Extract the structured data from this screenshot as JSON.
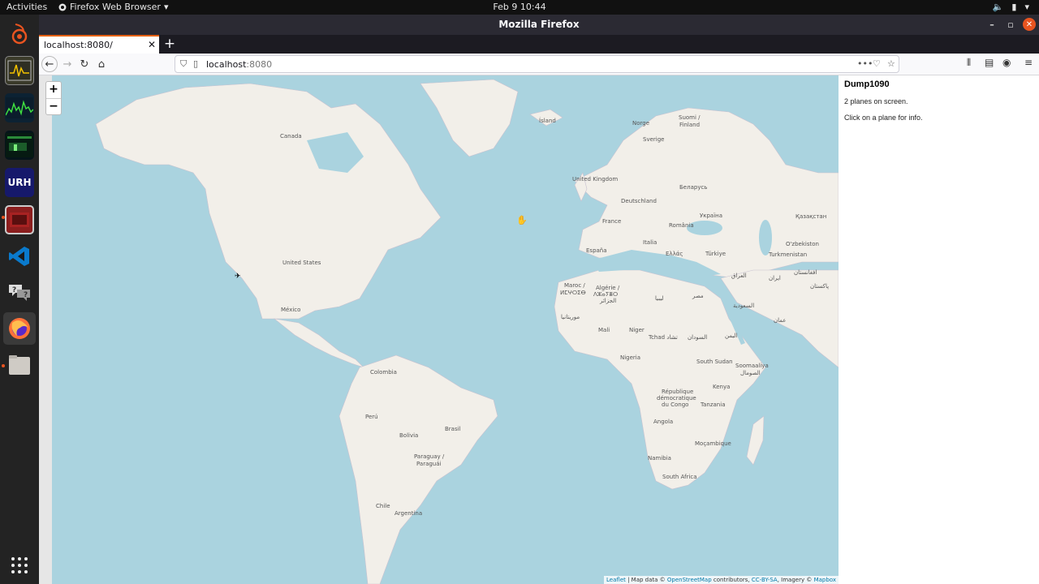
{
  "topbar": {
    "activities": "Activities",
    "app_menu": "Firefox Web Browser",
    "clock": "Feb 9  10:44"
  },
  "dock": {
    "items": [
      {
        "icon": "ubuntu-logo-icon"
      },
      {
        "icon": "oscilloscope-icon"
      },
      {
        "icon": "spectrum-icon"
      },
      {
        "icon": "waterfall-icon"
      },
      {
        "label": "URH",
        "icon": "urh-icon"
      },
      {
        "icon": "terminal-red-icon"
      },
      {
        "icon": "vscode-icon"
      },
      {
        "icon": "help-icon"
      },
      {
        "icon": "firefox-icon"
      },
      {
        "icon": "files-icon"
      },
      {
        "icon": "apps-grid-icon"
      }
    ]
  },
  "window": {
    "title": "Mozilla Firefox",
    "tab_title": "localhost:8080/",
    "url_host": "localhost",
    "url_port": ":8080"
  },
  "map": {
    "labels": [
      "Canada",
      "United States",
      "México",
      "Colombia",
      "Perú",
      "Brasil",
      "Bolivia",
      "Paraguay /",
      "Paraguái",
      "Chile",
      "Argentina",
      "Ísland",
      "Norge",
      "Sverige",
      "Suomi /",
      "Finland",
      "United Kingdom",
      "Deutschland",
      "France",
      "España",
      "Italia",
      "Беларусь",
      "Україна",
      "România",
      "Ελλάς",
      "Türkiye",
      "Қазақстан",
      "O'zbekiston",
      "Turkmenistan",
      "العراق",
      "ایران",
      "افغانستان",
      "پاکستان",
      "السعودية",
      "مصر",
      "ليبيا",
      "Maroc /",
      "ⵍⵎⵖⵔⵉⴱ",
      "Algérie /",
      "ⴷⵣⴰⵢⴻⵔ",
      "الجزائر",
      "موريتانيا",
      "Mali",
      "Niger",
      "Tchad تشاد",
      "السودان",
      "Nigeria",
      "South Sudan",
      "Soomaaliya",
      "الصومال",
      "Kenya",
      "République",
      "démocratique",
      "du Congo",
      "Tanzania",
      "Angola",
      "Namibia",
      "Moçambique",
      "South Africa",
      "اليمن",
      "عمان"
    ],
    "zoom_in": "+",
    "zoom_out": "−",
    "attribution": {
      "leaflet": "Leaflet",
      "text1": " | Map data © ",
      "osm": "OpenStreetMap",
      "text2": " contributors, ",
      "license": "CC-BY-SA",
      "text3": ", Imagery © ",
      "mapbox": "Mapbox"
    }
  },
  "panel": {
    "title": "Dump1090",
    "planes": "2 planes on screen.",
    "hint": "Click on a plane for info."
  }
}
